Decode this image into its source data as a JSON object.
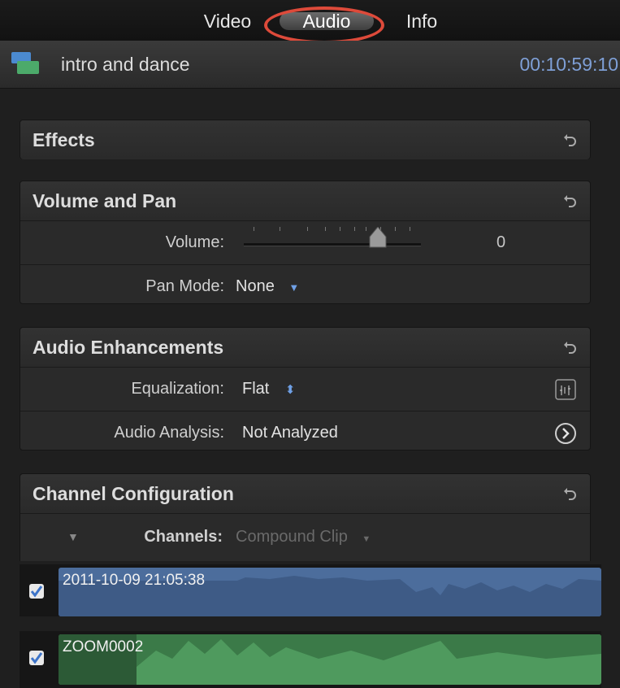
{
  "tabs": [
    {
      "label": "Video"
    },
    {
      "label": "Audio"
    },
    {
      "label": "Info"
    }
  ],
  "active_tab": "Audio",
  "clip": {
    "name": "intro and dance",
    "timecode": "00:10:59:10"
  },
  "sections": {
    "effects": {
      "title": "Effects"
    },
    "volume_pan": {
      "title": "Volume and Pan",
      "volume_label": "Volume:",
      "volume_value": "0",
      "pan_mode_label": "Pan Mode:",
      "pan_mode_value": "None"
    },
    "audio_enhancements": {
      "title": "Audio Enhancements",
      "equalization_label": "Equalization:",
      "equalization_value": "Flat",
      "analysis_label": "Audio Analysis:",
      "analysis_value": "Not Analyzed"
    },
    "channel_config": {
      "title": "Channel Configuration",
      "channels_label": "Channels:",
      "channels_value": "Compound Clip"
    }
  },
  "channels": [
    {
      "name": "2011-10-09 21:05:38",
      "checked": true,
      "color": "#4e6f9f"
    },
    {
      "name": "ZOOM0002",
      "checked": true,
      "color": "#4f9a5e"
    }
  ],
  "colors": {
    "highlight_ring": "#dd4a3a",
    "timecode": "#7e9fd6"
  },
  "icons": {
    "reset": "reset-arrow-icon",
    "eq": "eq-graph-icon",
    "analysis": "chevron-circle-right-icon"
  }
}
